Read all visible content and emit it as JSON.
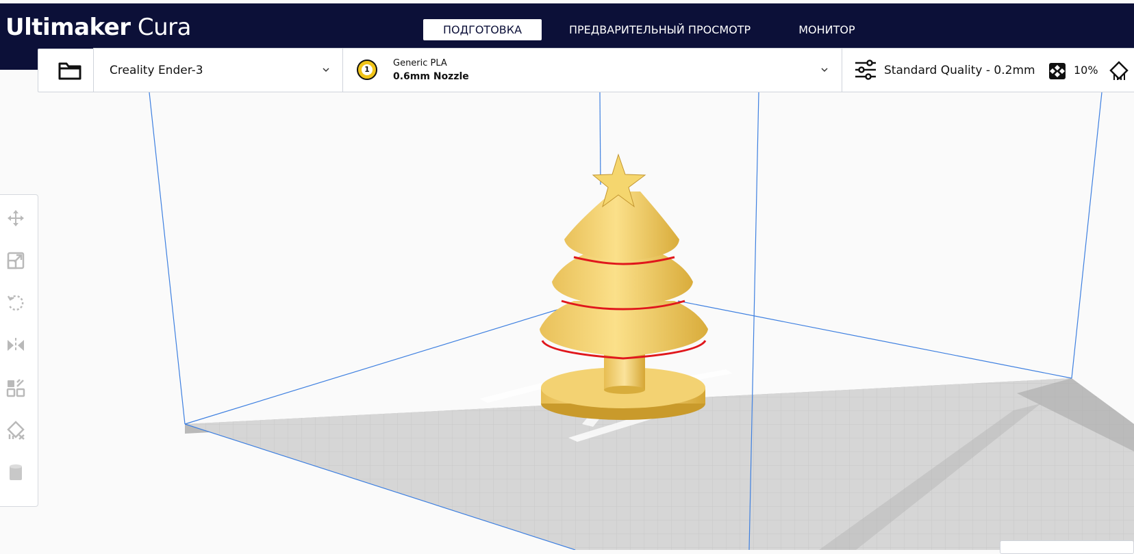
{
  "app": {
    "brand": "Ultimaker",
    "product": "Cura"
  },
  "stages": [
    {
      "label": "ПОДГОТОВКА",
      "active": true
    },
    {
      "label": "ПРЕДВАРИТЕЛЬНЫЙ ПРОСМОТР",
      "active": false
    },
    {
      "label": "МОНИТОР",
      "active": false
    }
  ],
  "toolbar": {
    "open_icon": "folder-icon",
    "printer": "Creality Ender-3",
    "extruder_number": "1",
    "material": "Generic PLA",
    "nozzle": "0.6mm Nozzle",
    "quality": "Standard Quality - 0.2mm",
    "infill": "10%"
  },
  "tools": [
    {
      "name": "move-icon"
    },
    {
      "name": "scale-icon"
    },
    {
      "name": "rotate-icon"
    },
    {
      "name": "mirror-icon"
    },
    {
      "name": "per-model-settings-icon"
    },
    {
      "name": "support-blocker-icon"
    },
    {
      "name": "cylinder-icon"
    }
  ],
  "colors": {
    "header": "#0c1038",
    "model": "#f5d66e",
    "model_shadow": "#d9ad3a",
    "overhang": "#e0171c",
    "build_volume": "#3d7fe0",
    "plate": "#d3d3d3"
  }
}
